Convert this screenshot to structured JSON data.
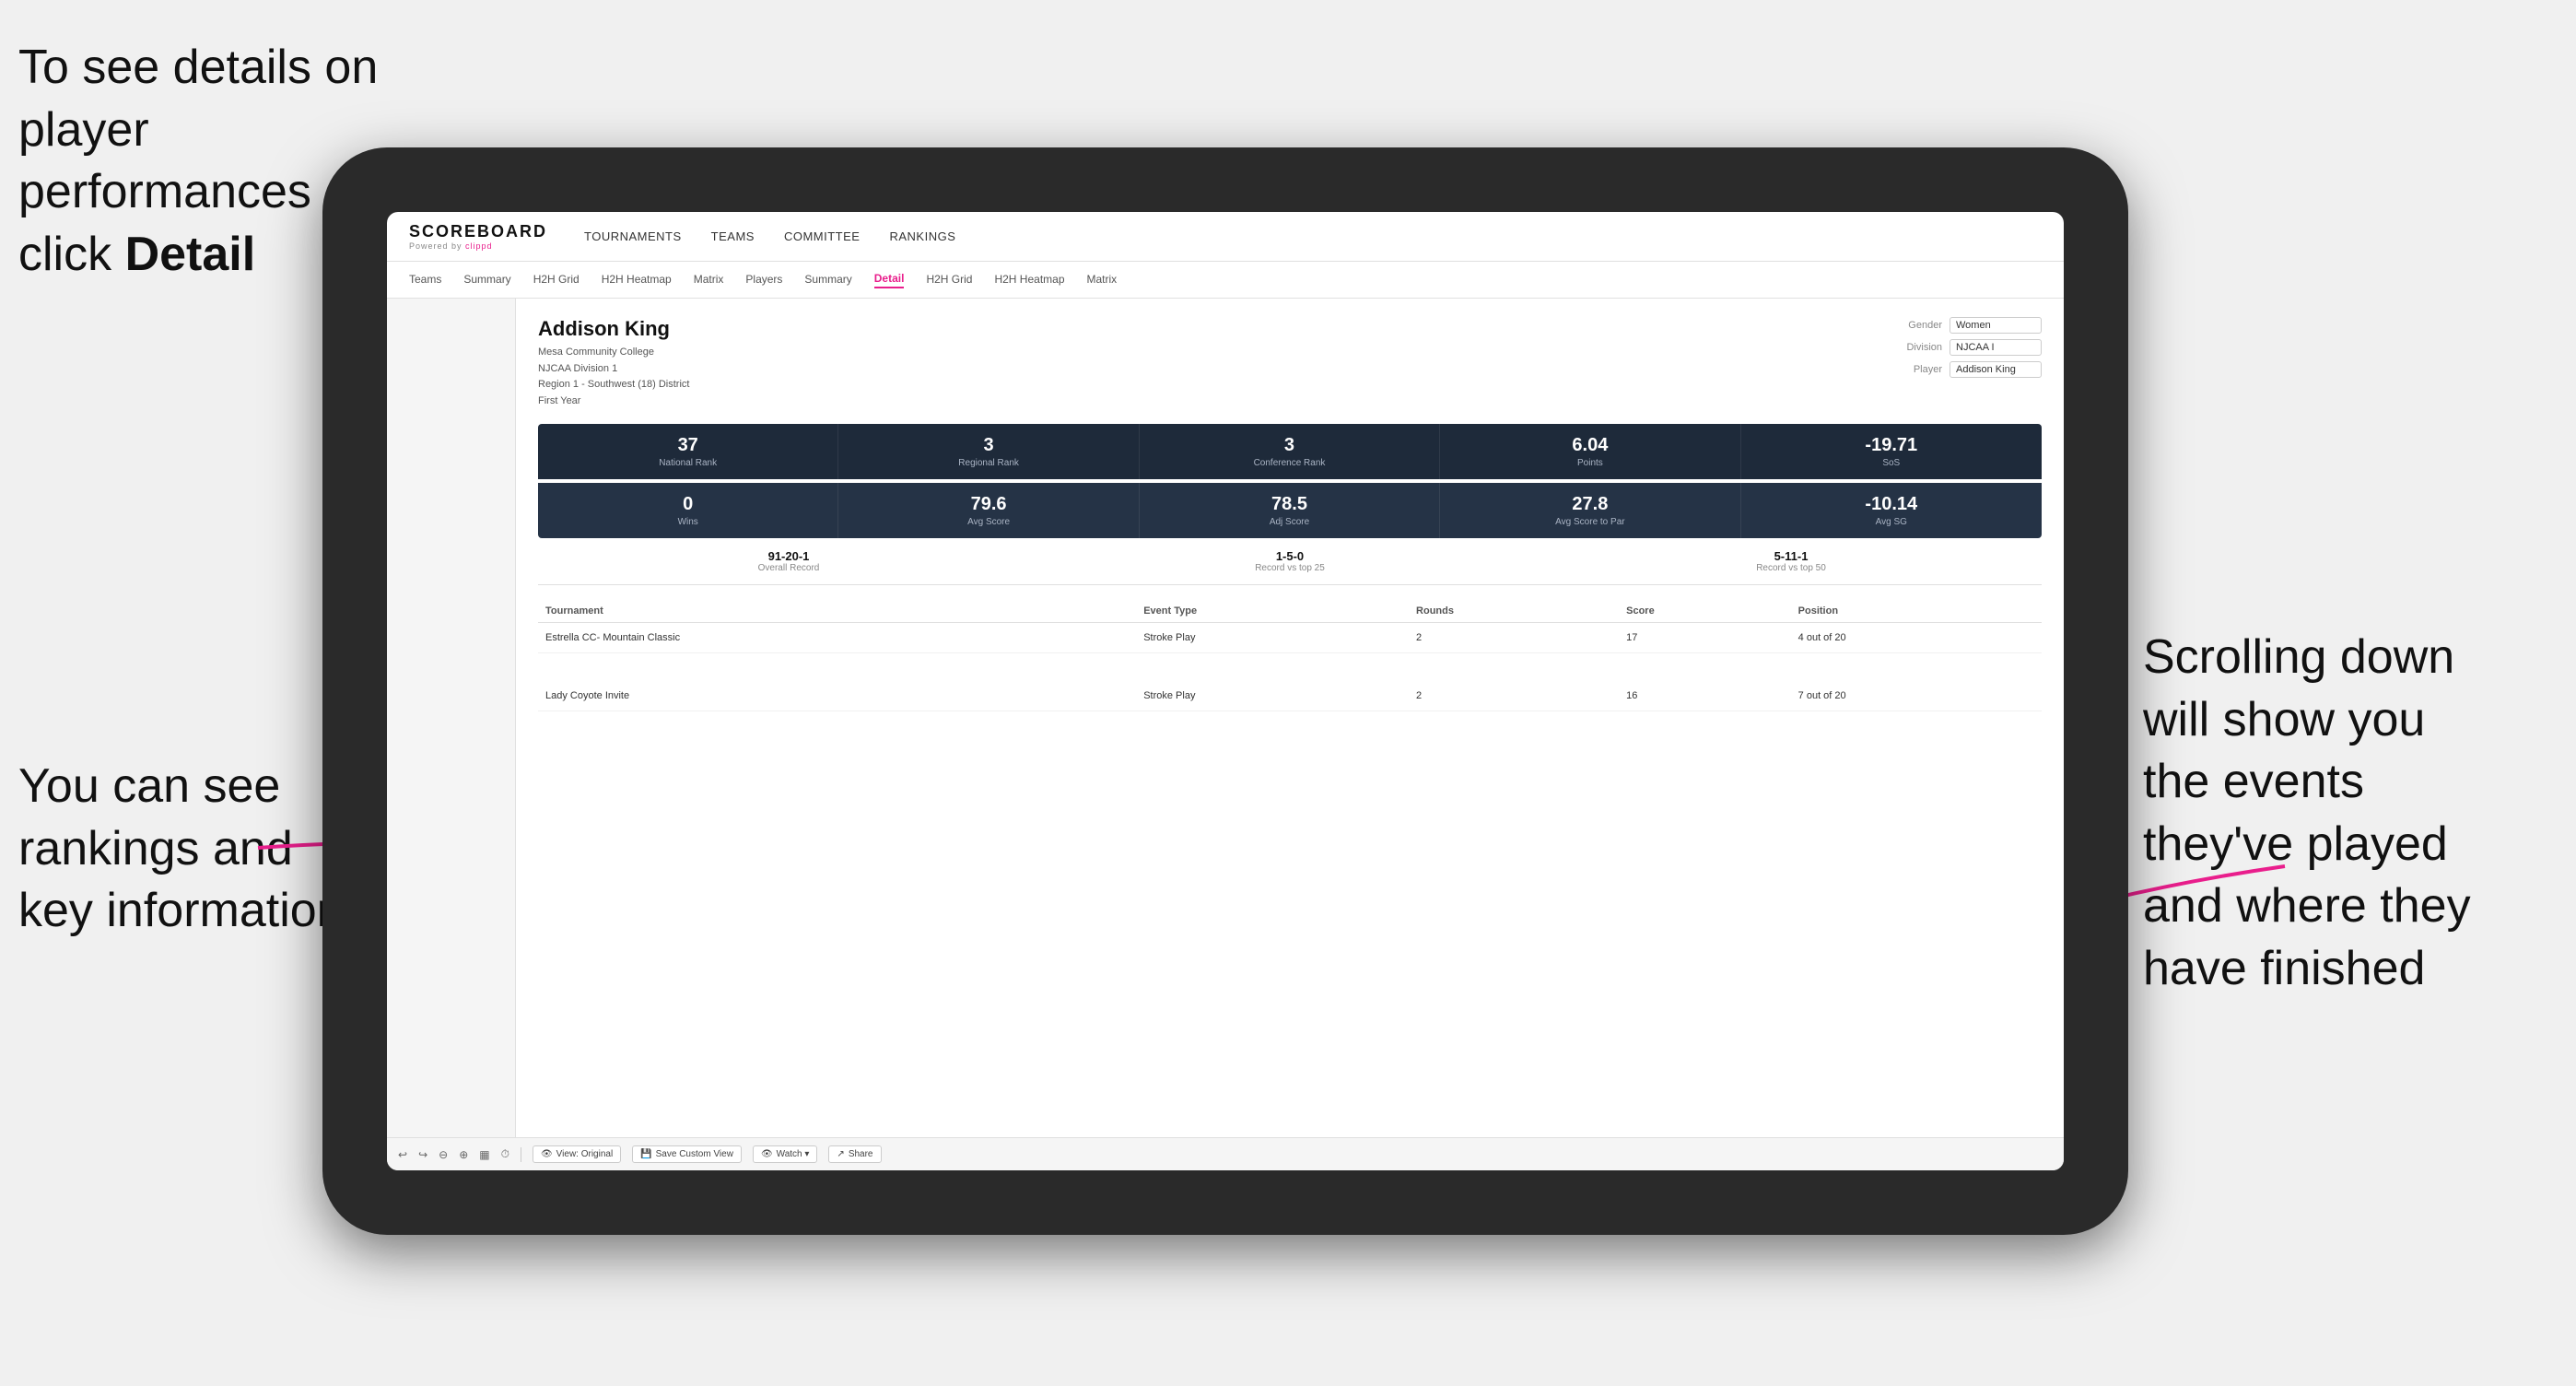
{
  "annotations": {
    "top_left": "To see details on player performances click ",
    "top_left_bold": "Detail",
    "bottom_left_line1": "You can see",
    "bottom_left_line2": "rankings and",
    "bottom_left_line3": "key information",
    "right_line1": "Scrolling down",
    "right_line2": "will show you",
    "right_line3": "the events",
    "right_line4": "they've played",
    "right_line5": "and where they",
    "right_line6": "have finished"
  },
  "nav": {
    "logo": "SCOREBOARD",
    "logo_sub": "Powered by clippd",
    "items": [
      "TOURNAMENTS",
      "TEAMS",
      "COMMITTEE",
      "RANKINGS"
    ]
  },
  "sub_nav": {
    "items": [
      "Teams",
      "Summary",
      "H2H Grid",
      "H2H Heatmap",
      "Matrix",
      "Players",
      "Summary",
      "Detail",
      "H2H Grid",
      "H2H Heatmap",
      "Matrix"
    ],
    "active": "Detail"
  },
  "player": {
    "name": "Addison King",
    "school": "Mesa Community College",
    "division": "NJCAA Division 1",
    "region": "Region 1 - Southwest (18) District",
    "year": "First Year"
  },
  "filters": {
    "gender_label": "Gender",
    "gender_value": "Women",
    "division_label": "Division",
    "division_value": "NJCAA I",
    "player_label": "Player",
    "player_value": "Addison King"
  },
  "stats_row1": [
    {
      "value": "37",
      "label": "National Rank"
    },
    {
      "value": "3",
      "label": "Regional Rank"
    },
    {
      "value": "3",
      "label": "Conference Rank"
    },
    {
      "value": "6.04",
      "label": "Points"
    },
    {
      "value": "-19.71",
      "label": "SoS"
    }
  ],
  "stats_row2": [
    {
      "value": "0",
      "label": "Wins"
    },
    {
      "value": "79.6",
      "label": "Avg Score"
    },
    {
      "value": "78.5",
      "label": "Adj Score"
    },
    {
      "value": "27.8",
      "label": "Avg Score to Par"
    },
    {
      "value": "-10.14",
      "label": "Avg SG"
    }
  ],
  "records": [
    {
      "value": "91-20-1",
      "label": "Overall Record"
    },
    {
      "value": "1-5-0",
      "label": "Record vs top 25"
    },
    {
      "value": "5-11-1",
      "label": "Record vs top 50"
    }
  ],
  "table": {
    "headers": [
      "Tournament",
      "Event Type",
      "Rounds",
      "Score",
      "Position"
    ],
    "rows": [
      {
        "tournament": "Estrella CC- Mountain Classic",
        "event_type": "Stroke Play",
        "rounds": "2",
        "score": "17",
        "position": "4 out of 20"
      },
      {
        "tournament": "Lady Coyote Invite",
        "event_type": "Stroke Play",
        "rounds": "2",
        "score": "16",
        "position": "7 out of 20"
      }
    ]
  },
  "toolbar": {
    "buttons": [
      "View: Original",
      "Save Custom View",
      "Watch ▾",
      "Share"
    ]
  }
}
